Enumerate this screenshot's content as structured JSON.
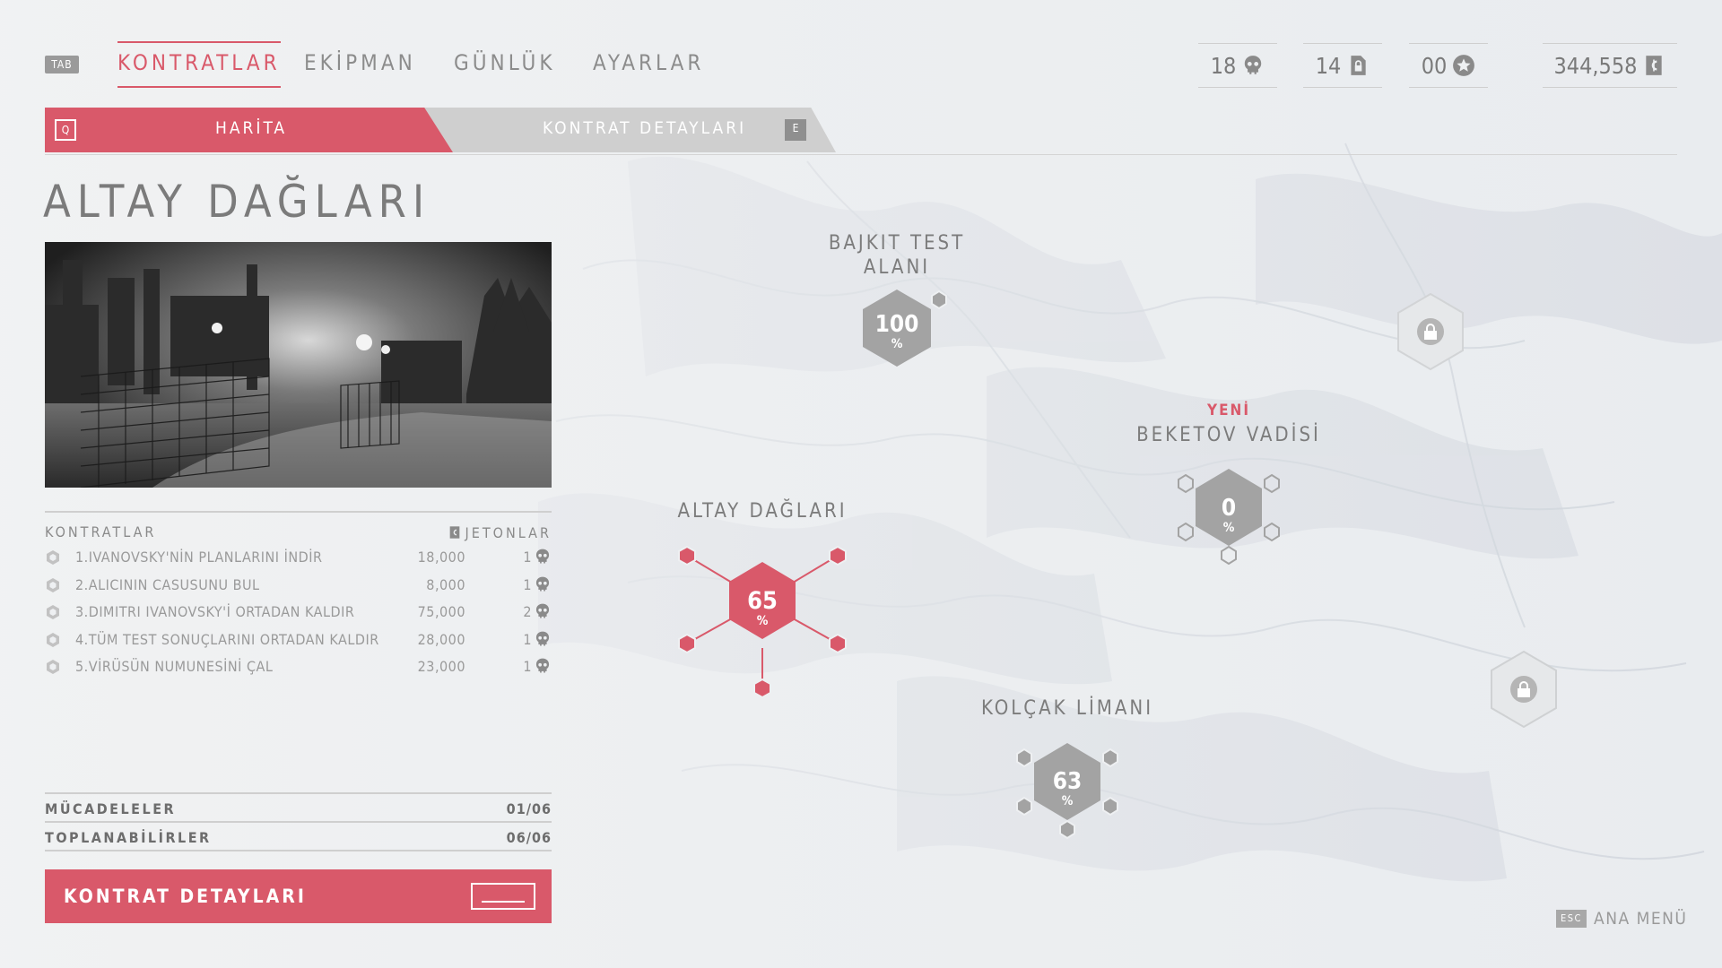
{
  "top_nav": {
    "tab_key": "TAB",
    "items": [
      {
        "label": "KONTRATLAR",
        "active": true
      },
      {
        "label": "EKİPMAN",
        "active": false
      },
      {
        "label": "GÜNLÜK",
        "active": false
      },
      {
        "label": "AYARLAR",
        "active": false
      }
    ]
  },
  "stats": {
    "kills": "18",
    "intel": "14",
    "stars": "00",
    "credits": "344,558"
  },
  "subtabs": {
    "left_key": "Q",
    "left_label": "HARİTA",
    "right_label": "KONTRAT DETAYLARI",
    "right_key": "E"
  },
  "panel": {
    "region_title": "ALTAY DAĞLARI",
    "list_header_left": "KONTRATLAR",
    "list_header_right": "JETONLAR",
    "contracts": [
      {
        "name": "1.IVANOVSKY'NİN PLANLARINI İNDİR",
        "reward": "18,000",
        "tokens": "1"
      },
      {
        "name": "2.ALICININ CASUSUNU BUL",
        "reward": "8,000",
        "tokens": "1"
      },
      {
        "name": "3.DIMITRI IVANOVSKY'İ ORTADAN KALDIR",
        "reward": "75,000",
        "tokens": "2"
      },
      {
        "name": "4.TÜM TEST SONUÇLARINI ORTADAN KALDIR",
        "reward": "28,000",
        "tokens": "1"
      },
      {
        "name": "5.VİRÜSÜN NUMUNESİNİ ÇAL",
        "reward": "23,000",
        "tokens": "1"
      }
    ],
    "challenges_label": "MÜCADELELER",
    "challenges_value": "01/06",
    "collectibles_label": "TOPLANABİLİRLER",
    "collectibles_value": "06/06",
    "cta_label": "KONTRAT DETAYLARI"
  },
  "map": {
    "bajkit": {
      "label_line1": "BAJKIT TEST",
      "label_line2": "ALANI",
      "pct": "100",
      "unit": "%"
    },
    "beketov": {
      "new_tag": "YENİ",
      "label": "BEKETOV VADİSİ",
      "pct": "0",
      "unit": "%"
    },
    "altay": {
      "label": "ALTAY DAĞLARI",
      "pct": "65",
      "unit": "%"
    },
    "kolcak": {
      "label": "KOLÇAK LİMANI",
      "pct": "63",
      "unit": "%"
    },
    "locked_icon": "lock-icon"
  },
  "footer": {
    "esc_key": "ESC",
    "menu_label": "ANA MENÜ"
  },
  "colors": {
    "accent": "#d9596a",
    "node_grey": "#a3a3a3",
    "text_grey": "#7c7c7c"
  }
}
